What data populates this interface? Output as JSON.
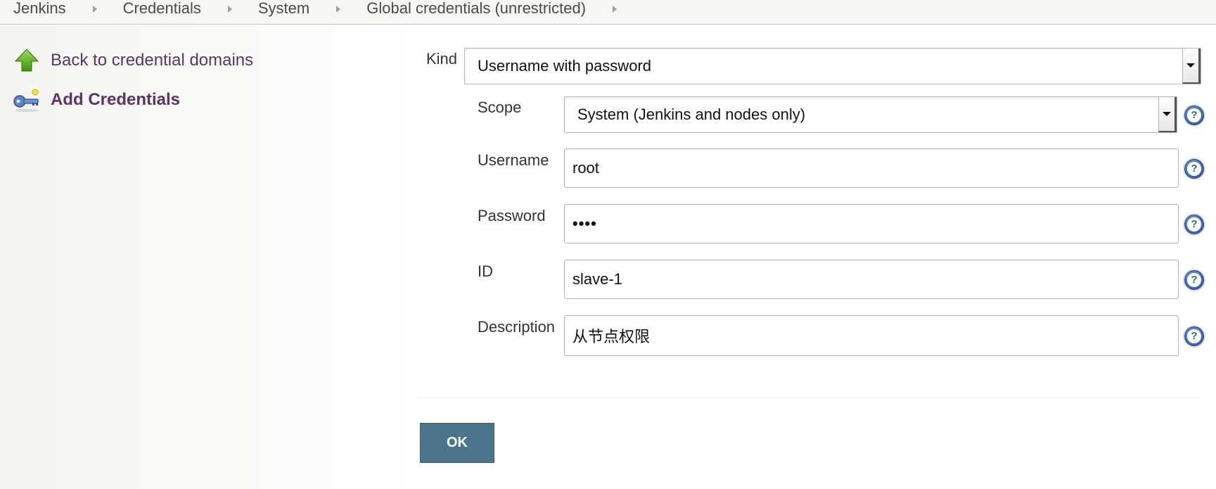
{
  "breadcrumb": {
    "items": [
      {
        "label": "Jenkins"
      },
      {
        "label": "Credentials"
      },
      {
        "label": "System"
      },
      {
        "label": "Global credentials (unrestricted)"
      }
    ]
  },
  "side_panel": {
    "tasks": [
      {
        "label": "Back to credential domains",
        "icon": "up-arrow-icon"
      },
      {
        "label": "Add Credentials",
        "icon": "key-icon",
        "current": true
      }
    ]
  },
  "form": {
    "kind": {
      "label": "Kind",
      "value": "Username with password"
    },
    "scope": {
      "label": "Scope",
      "value": "System (Jenkins and nodes only)"
    },
    "username": {
      "label": "Username",
      "value": "root"
    },
    "password": {
      "label": "Password",
      "value": "••••"
    },
    "id": {
      "label": "ID",
      "value": "slave-1"
    },
    "description": {
      "label": "Description",
      "value": "从节点权限"
    },
    "help_glyph": "?",
    "ok_label": "OK"
  },
  "colors": {
    "link": "#5c3566",
    "button": "#4b758b",
    "help": "#4a6cb5"
  }
}
